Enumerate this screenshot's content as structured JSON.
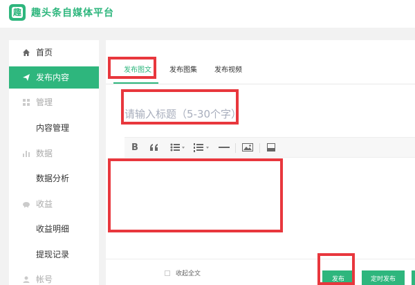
{
  "header": {
    "logo_char": "趣",
    "brand": "趣头条自媒体平台"
  },
  "sidebar": {
    "items": [
      {
        "label": "首页",
        "icon": "home-icon"
      },
      {
        "label": "发布内容",
        "icon": "send-icon"
      },
      {
        "label": "管理",
        "icon": "grid-icon"
      },
      {
        "label": "内容管理"
      },
      {
        "label": "数据",
        "icon": "bar-chart-icon"
      },
      {
        "label": "数据分析"
      },
      {
        "label": "收益",
        "icon": "piggy-bank-icon"
      },
      {
        "label": "收益明细"
      },
      {
        "label": "提现记录"
      },
      {
        "label": "帐号",
        "icon": "user-icon"
      }
    ]
  },
  "main": {
    "tabs": [
      "发布图文",
      "发布图集",
      "发布视频"
    ],
    "title_placeholder": "请输入标题（5-30个字）",
    "footer": {
      "collapse_label": "收起全文",
      "publish_label": "发布",
      "schedule_label": "定时发布"
    }
  },
  "colors": {
    "accent": "#2eb67d",
    "highlight": "#e8373d"
  }
}
